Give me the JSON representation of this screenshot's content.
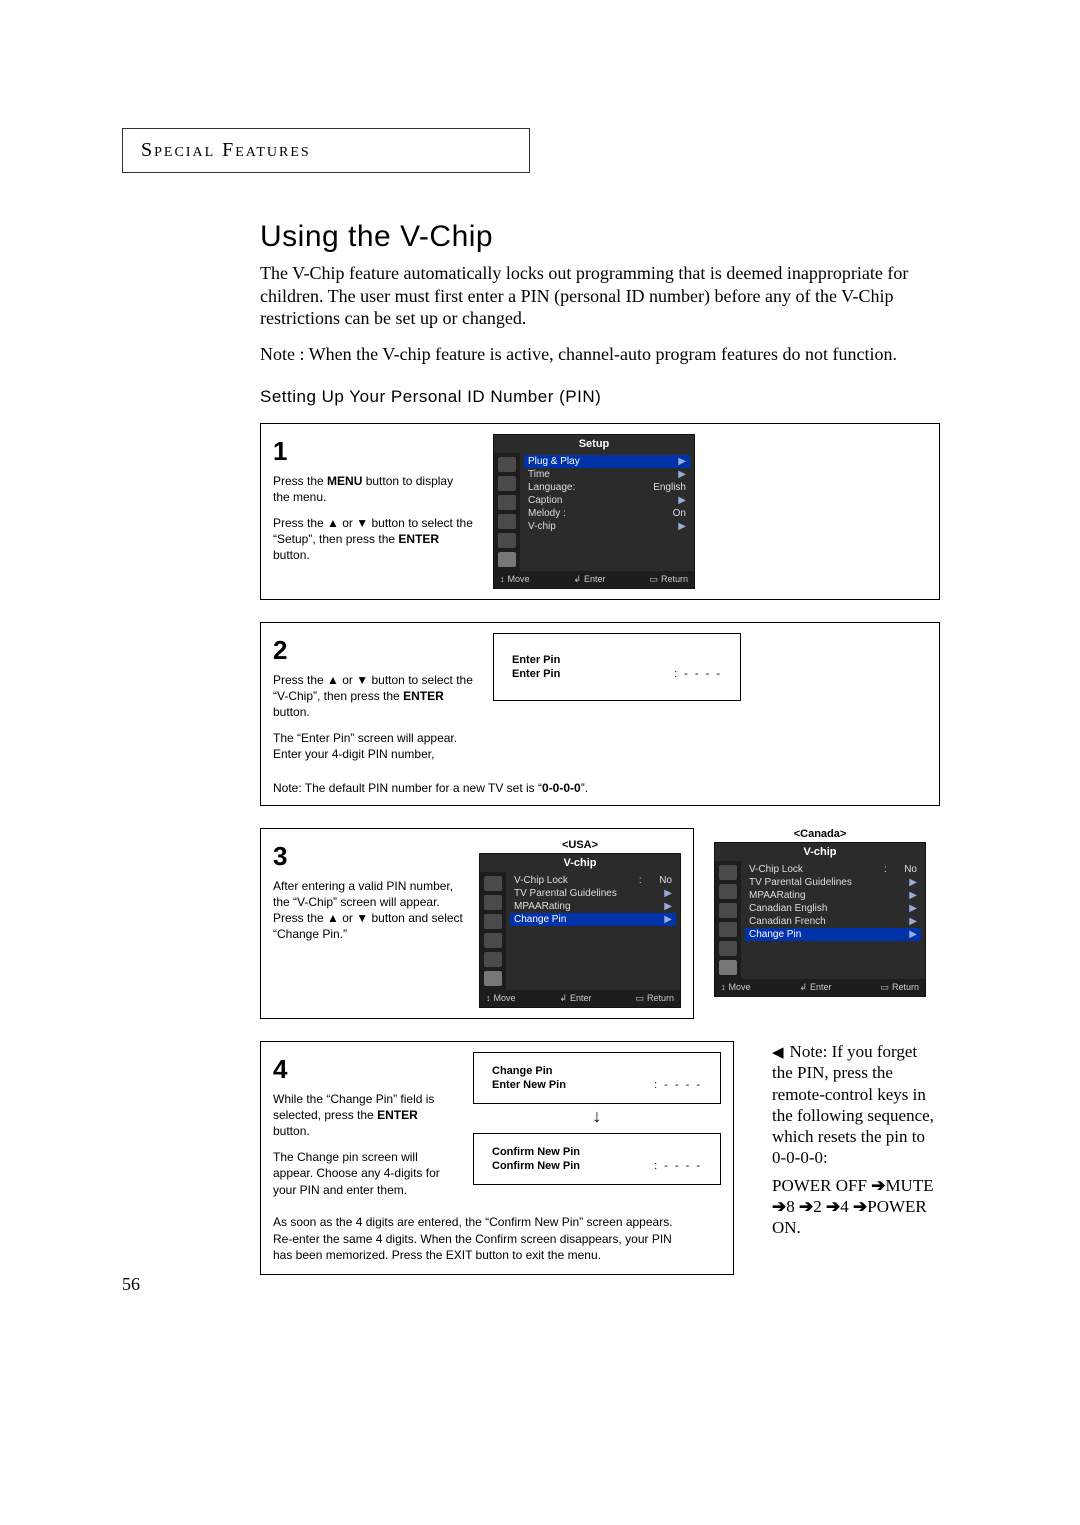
{
  "header": "Special Features",
  "title": "Using the V-Chip",
  "intro": "The V-Chip feature automatically locks out programming that is deemed inappropriate for children. The user must first enter a PIN (personal ID number) before any of the V-Chip restrictions can be set up or changed.",
  "active_note": "Note : When the V-chip feature is active, channel-auto program features do not function.",
  "sub": "Setting Up Your Personal ID Number (PIN)",
  "step1": {
    "num": "1",
    "p1a": "Press the ",
    "p1b": "MENU",
    "p1c": " button to display the menu.",
    "p2a": "Press the ",
    "p2b": " or ",
    "p2c": " button to select the “Setup”, then press the ",
    "p2d": "ENTER",
    "p2e": " button."
  },
  "osd_setup": {
    "title": "Setup",
    "items": [
      {
        "label": "Plug & Play",
        "chev": "▶",
        "selected": true
      },
      {
        "label": "Time",
        "chev": "▶"
      },
      {
        "label": "Language:",
        "val": "English"
      },
      {
        "label": "Caption",
        "chev": "▶"
      },
      {
        "label": "Melody  :",
        "val": "On"
      },
      {
        "label": "V-chip",
        "chev": "▶"
      }
    ],
    "footer": {
      "move": "Move",
      "enter": "Enter",
      "return": "Return"
    }
  },
  "step2": {
    "num": "2",
    "p1a": "Press the ",
    "p1b": " or ",
    "p1c": " button to select  the “V-Chip”, then press the ",
    "p1d": "ENTER",
    "p1e": " button.",
    "p2": "The “Enter Pin” screen will appear. Enter your 4-digit PIN number,",
    "default_a": "Note: The default PIN number for a new TV set is “",
    "default_b": "0-0-0-0",
    "default_c": "”."
  },
  "enter_pin": {
    "l1": "Enter Pin",
    "l2": "Enter Pin",
    "dots": ": - - - -"
  },
  "step3": {
    "num": "3",
    "p1a": "After entering a valid PIN number, the “V-Chip” screen will appear. Press the ",
    "p1b": " or ",
    "p1c": " button and select “Change Pin.”"
  },
  "usa_label": "<USA>",
  "canada_label": "<Canada>",
  "osd_vchip_usa": {
    "title": "V-chip",
    "items": [
      {
        "label": "V-Chip Lock",
        "colon": ":",
        "val": "No"
      },
      {
        "label": "TV Parental Guidelines",
        "chev": "▶"
      },
      {
        "label": "MPAARating",
        "chev": "▶"
      },
      {
        "label": "Change Pin",
        "chev": "▶",
        "selected": true
      }
    ],
    "footer": {
      "move": "Move",
      "enter": "Enter",
      "return": "Return"
    }
  },
  "osd_vchip_can": {
    "title": "V-chip",
    "items": [
      {
        "label": "V-Chip Lock",
        "colon": ":",
        "val": "No"
      },
      {
        "label": "TV Parental Guidelines",
        "chev": "▶"
      },
      {
        "label": "MPAARating",
        "chev": "▶"
      },
      {
        "label": "Canadian English",
        "chev": "▶"
      },
      {
        "label": "Canadian French",
        "chev": "▶"
      },
      {
        "label": "Change Pin",
        "chev": "▶",
        "selected": true
      }
    ],
    "footer": {
      "move": "Move",
      "enter": "Enter",
      "return": "Return"
    }
  },
  "step4": {
    "num": "4",
    "p1a": "While the “Change Pin” field is selected, press the ",
    "p1b": "ENTER",
    "p1c": " button.",
    "p2": "The Change pin screen will appear. Choose any 4-digits for your PIN and enter them.",
    "post": "As soon as the 4 digits are entered, the “Confirm New Pin” screen appears. Re-enter the same 4 digits. When the Confirm screen disappears, your PIN has been memorized.\nPress the EXIT button to exit the menu."
  },
  "change_pin": {
    "l1": "Change Pin",
    "l2": "Enter New Pin",
    "dots": ": - - - -"
  },
  "confirm_pin": {
    "l1": "Confirm New Pin",
    "l2": "Confirm New Pin",
    "dots": ": - - - -"
  },
  "side_note": {
    "l1": "Note: If you forget the PIN, press the remote-control keys in the following sequence, which resets the pin to 0-0-0-0:",
    "seq": [
      "POWER OFF",
      "MUTE",
      "8",
      "2",
      "4",
      "POWER ON."
    ]
  },
  "page_num": "56"
}
